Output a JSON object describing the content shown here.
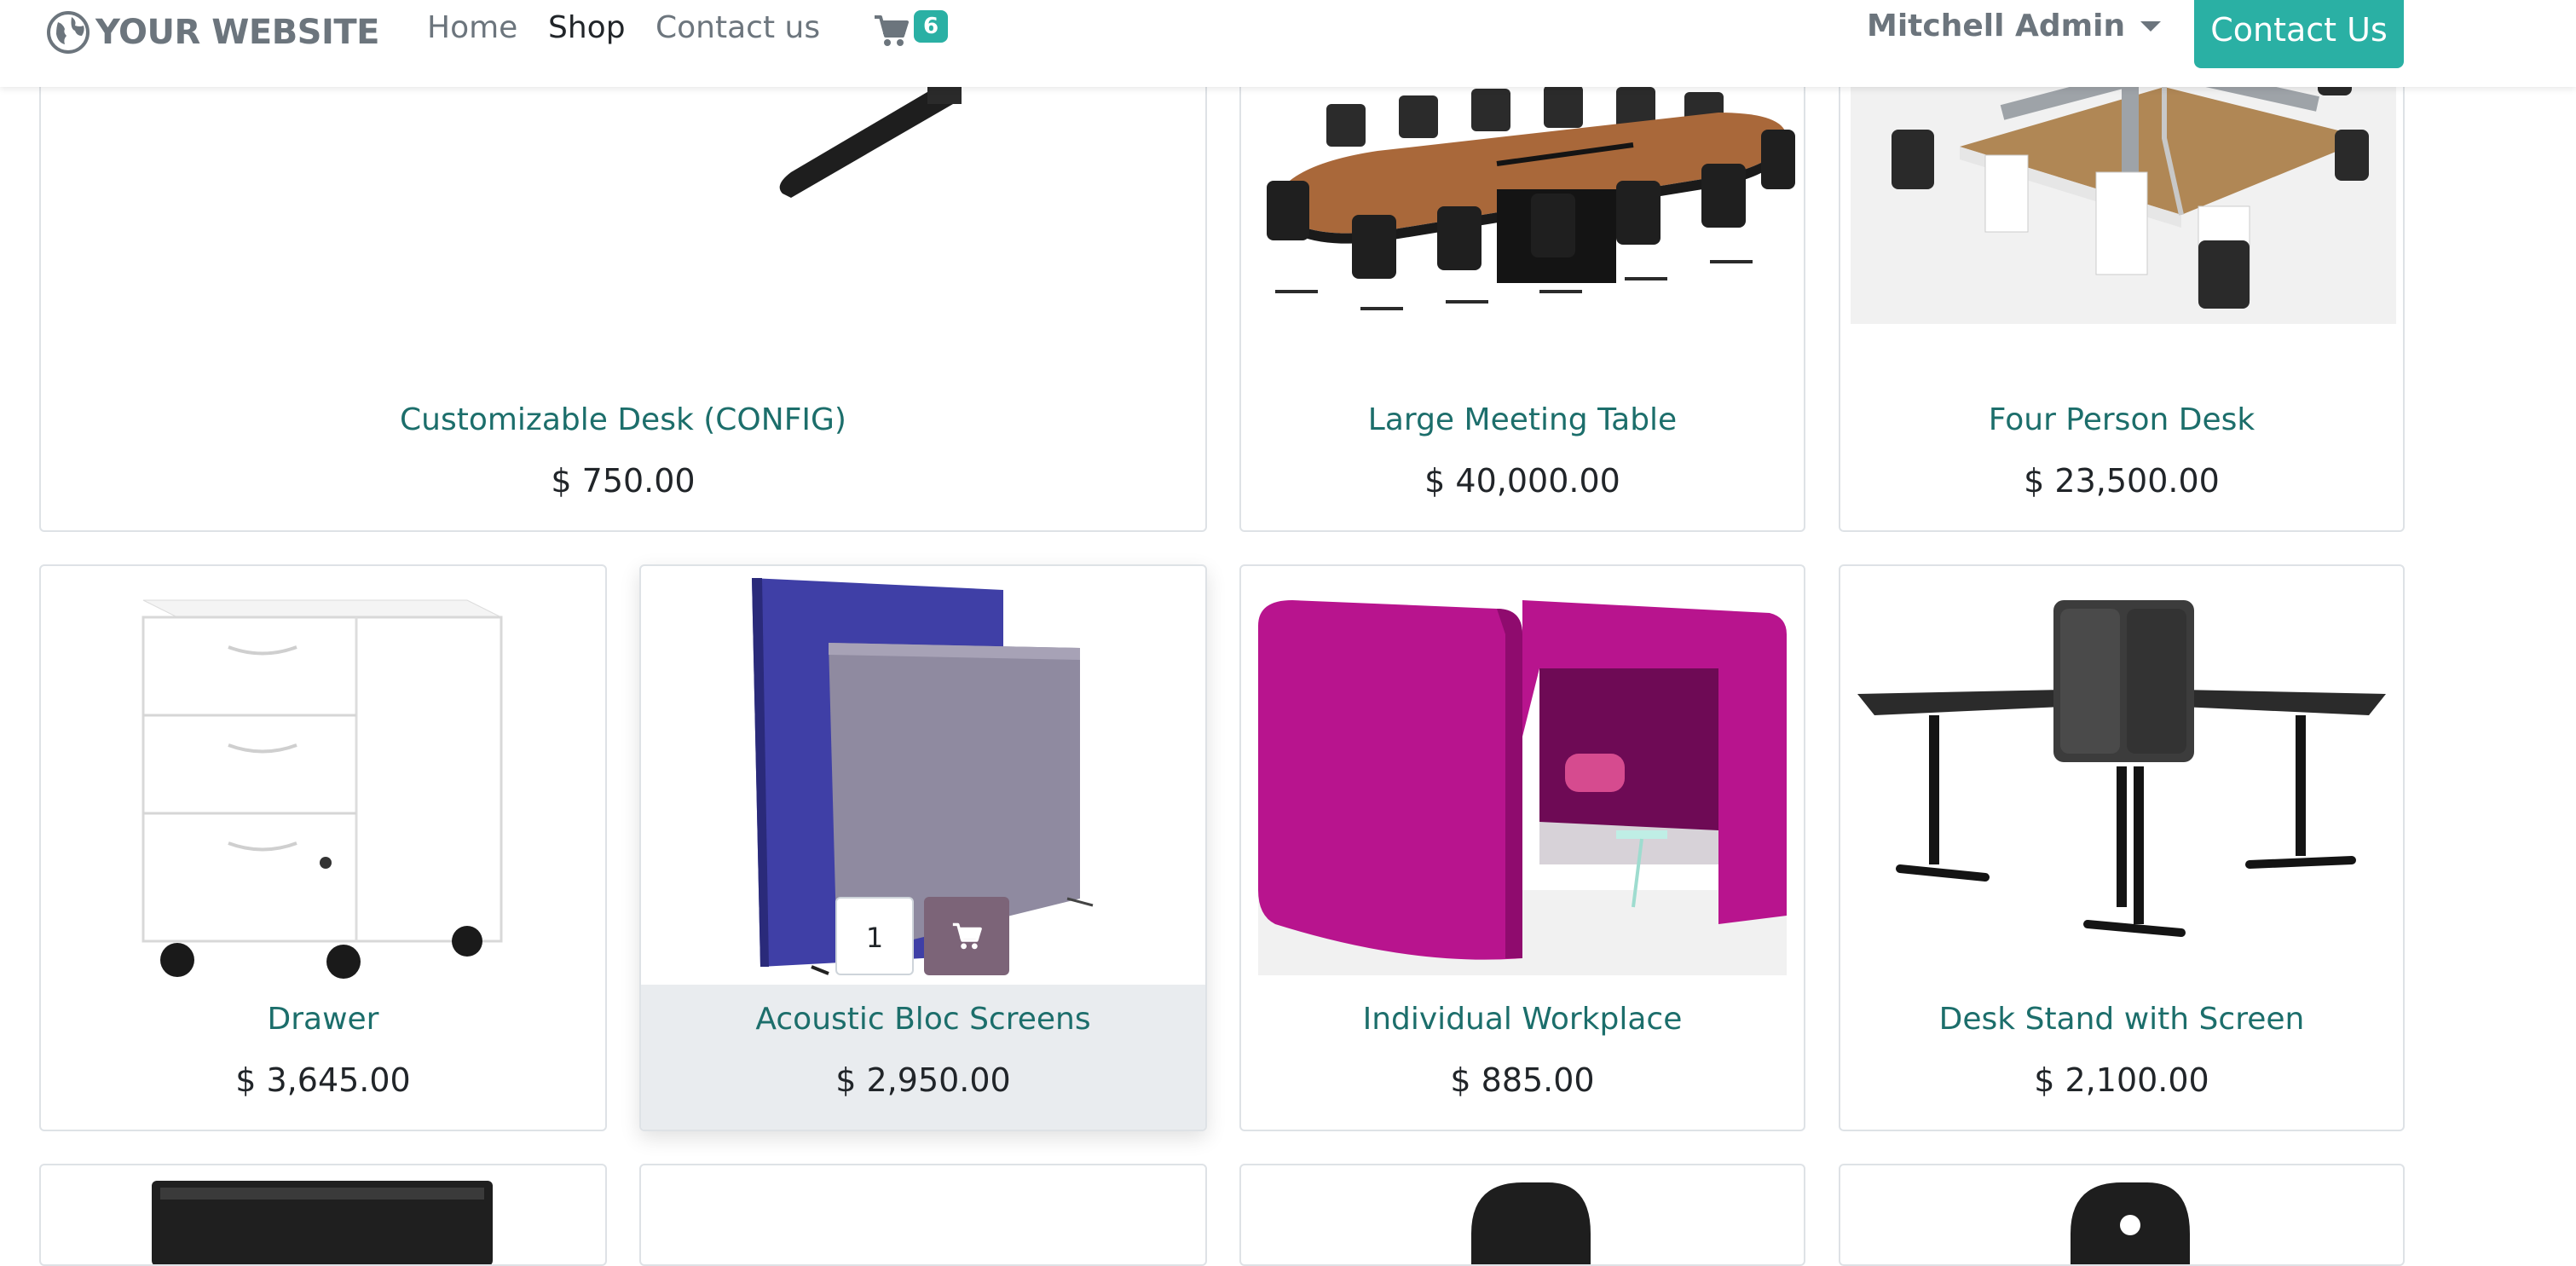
{
  "header": {
    "logo_text": "YOUR WEBSITE",
    "nav": {
      "home": "Home",
      "shop": "Shop",
      "contact": "Contact us"
    },
    "cart_count": "6",
    "user_name": "Mitchell Admin",
    "contact_button": "Contact Us"
  },
  "products": [
    {
      "name": "Customizable Desk (CONFIG)",
      "price": "$ 750.00"
    },
    {
      "name": "Large Meeting Table",
      "price": "$ 40,000.00"
    },
    {
      "name": "Four Person Desk",
      "price": "$ 23,500.00"
    },
    {
      "name": "Drawer",
      "price": "$ 3,645.00"
    },
    {
      "name": "Acoustic Bloc Screens",
      "price": "$ 2,950.00",
      "quantity": "1"
    },
    {
      "name": "Individual Workplace",
      "price": "$ 885.00"
    },
    {
      "name": "Desk Stand with Screen",
      "price": "$ 2,100.00"
    }
  ],
  "colors": {
    "accent": "#2ab0a4",
    "product_link": "#1c6e6b",
    "add_to_cart": "#7c6478"
  },
  "icons": {
    "logo": "globe-icon",
    "cart": "shopping-cart-icon",
    "user_menu": "caret-down-icon",
    "add_to_cart": "cart-icon"
  }
}
